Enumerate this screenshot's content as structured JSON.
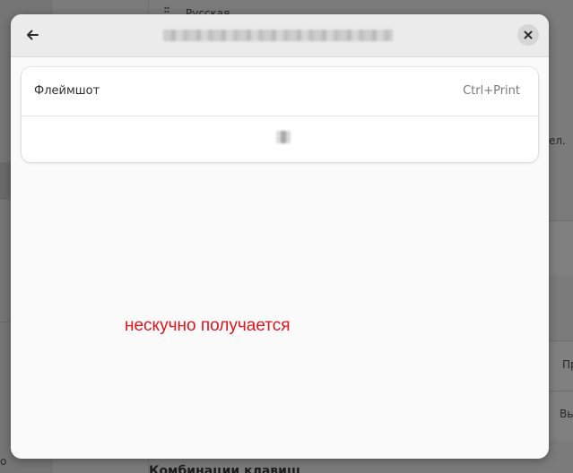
{
  "background": {
    "header_text": "Русская",
    "side_text_1": "ел.",
    "side_button_1": "Пр",
    "side_button_2": "Вы",
    "sidebar_text": "о",
    "bottom_text": "Комбинации клавиш"
  },
  "dialog": {
    "back_icon": "arrow-left-icon",
    "close_icon": "close-icon",
    "row": {
      "label": "Флеймшот",
      "shortcut": "Ctrl+Print"
    }
  },
  "annotation": {
    "text": "нескучно получается",
    "color": "#e0141b"
  }
}
